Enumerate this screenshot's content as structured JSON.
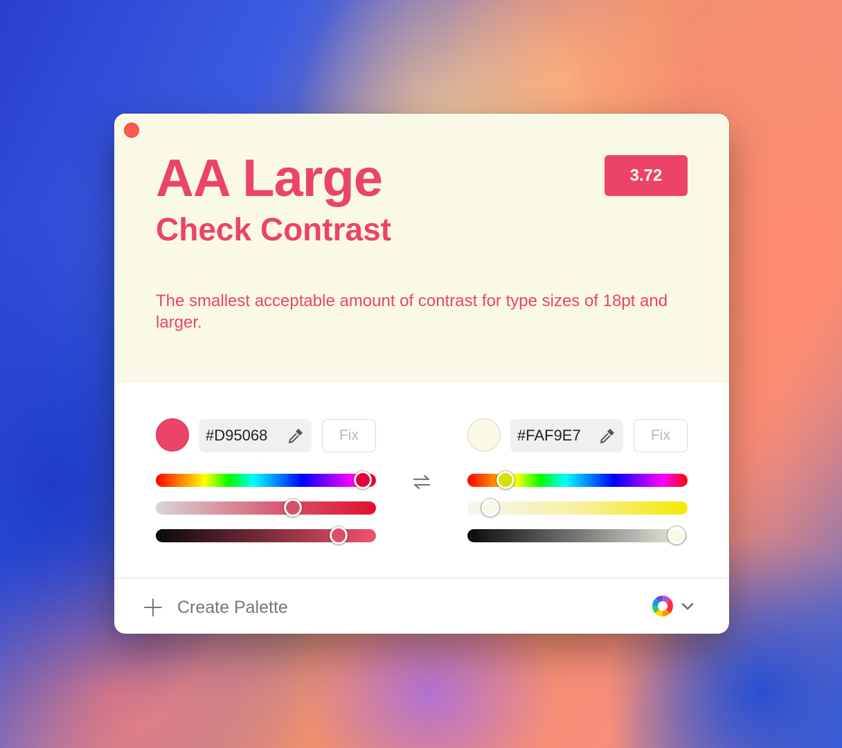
{
  "header": {
    "rating": "AA Large",
    "subtitle": "Check Contrast",
    "ratio": "3.72",
    "description": "The smallest acceptable amount of contrast for type sizes of 18pt and larger."
  },
  "foreground": {
    "hex": "#D95068",
    "fix_label": "Fix",
    "hue_level": 0.95,
    "saturation_level": 0.63,
    "brightness_level": 0.83
  },
  "background": {
    "hex": "#FAF9E7",
    "fix_label": "Fix",
    "hue_level": 0.17,
    "saturation_level": 0.1,
    "brightness_level": 0.95
  },
  "footer": {
    "create_palette_label": "Create Palette"
  },
  "colors": {
    "accent": "#EB4467",
    "top_background": "#FAF9E7",
    "close_button": "#FD5A4F"
  },
  "icons": [
    "close-icon",
    "eyedropper-icon",
    "swap-icon",
    "plus-icon",
    "color-wheel-icon",
    "chevron-down-icon"
  ]
}
